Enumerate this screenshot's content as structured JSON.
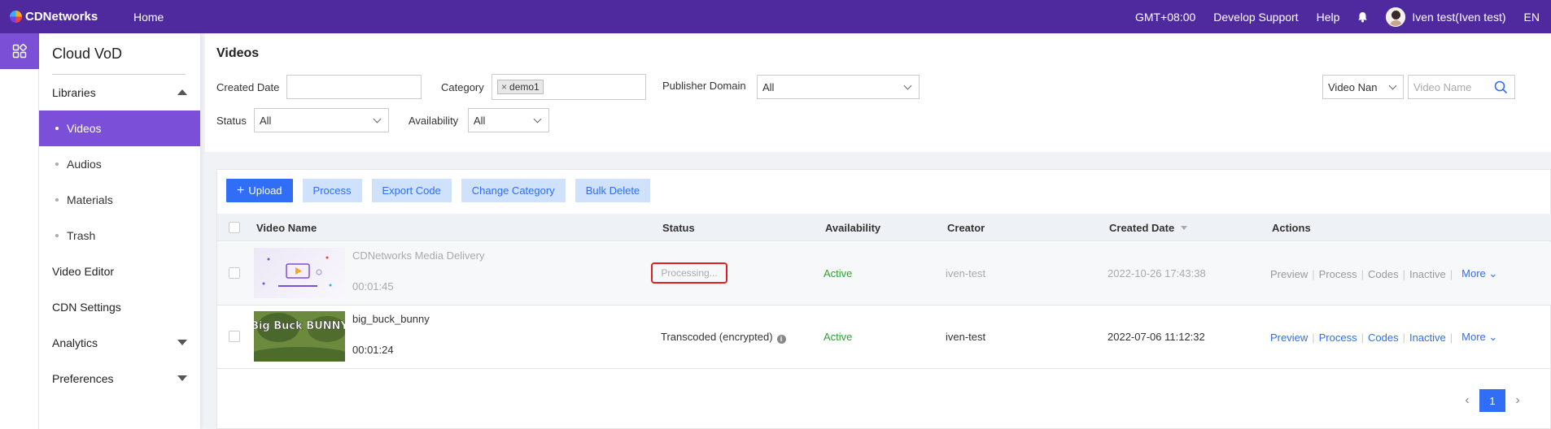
{
  "topbar": {
    "brand": "CDNetworks",
    "home": "Home",
    "timezone": "GMT+08:00",
    "develop_support": "Develop Support",
    "help": "Help",
    "user": "Iven test(Iven test)",
    "language": "EN"
  },
  "sidebar": {
    "title": "Cloud VoD",
    "libraries": "Libraries",
    "items": [
      {
        "label": "Videos"
      },
      {
        "label": "Audios"
      },
      {
        "label": "Materials"
      },
      {
        "label": "Trash"
      }
    ],
    "video_editor": "Video Editor",
    "cdn_settings": "CDN Settings",
    "analytics": "Analytics",
    "preferences": "Preferences"
  },
  "filters": {
    "page_title": "Videos",
    "created_date_label": "Created Date",
    "created_date_value": "",
    "category_label": "Category",
    "category_tag": "demo1",
    "publisher_domain_label": "Publisher Domain",
    "publisher_domain_value": "All",
    "status_label": "Status",
    "status_value": "All",
    "availability_label": "Availability",
    "availability_value": "All",
    "search_type": "Video Nan",
    "search_placeholder": "Video Name"
  },
  "toolbar": {
    "upload": "Upload",
    "process": "Process",
    "export_code": "Export Code",
    "change_category": "Change Category",
    "bulk_delete": "Bulk Delete"
  },
  "table": {
    "columns": {
      "video_name": "Video Name",
      "status": "Status",
      "availability": "Availability",
      "creator": "Creator",
      "created_date": "Created Date",
      "actions": "Actions"
    },
    "rows": [
      {
        "name": "CDNetworks Media Delivery",
        "duration": "00:01:45",
        "status": "Processing...",
        "availability": "Active",
        "creator": "iven-test",
        "created_date": "2022-10-26 17:43:38"
      },
      {
        "name": "big_buck_bunny",
        "duration": "00:01:24",
        "status": "Transcoded (encrypted)",
        "availability": "Active",
        "creator": "iven-test",
        "created_date": "2022-07-06 11:12:32",
        "thumb_text": "Big Buck BUNNY"
      }
    ],
    "action_labels": {
      "preview": "Preview",
      "process": "Process",
      "codes": "Codes",
      "inactive": "Inactive",
      "more": "More"
    }
  },
  "pagination": {
    "current_page": "1"
  },
  "colors": {
    "topbar": "#4f2a9f",
    "sidebar_active": "#7c4fd9",
    "primary": "#2f6ef5",
    "active_green": "#2fa32f",
    "highlight_red": "#e02020"
  }
}
